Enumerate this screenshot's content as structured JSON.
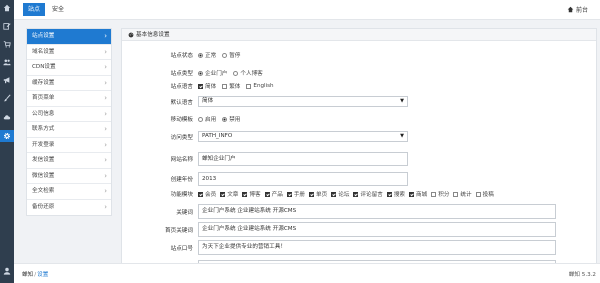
{
  "header": {
    "tabs": [
      "站点",
      "安全"
    ],
    "home_label": "前台"
  },
  "sidebar": {
    "items": [
      {
        "label": "站点设置"
      },
      {
        "label": "域名设置"
      },
      {
        "label": "CDN设置"
      },
      {
        "label": "缓存设置"
      },
      {
        "label": "首页菜单"
      },
      {
        "label": "公司信息"
      },
      {
        "label": "联系方式"
      },
      {
        "label": "开发登录"
      },
      {
        "label": "发信设置"
      },
      {
        "label": "微信设置"
      },
      {
        "label": "全文检索"
      },
      {
        "label": "备份还原"
      }
    ]
  },
  "panel": {
    "title": "基本信息设置",
    "site_status": {
      "label": "站点状态",
      "options": [
        "正常",
        "暂停"
      ],
      "selected": "正常"
    },
    "site_type": {
      "label": "站点类型",
      "options": [
        "企业门户",
        "个人博客"
      ],
      "selected": "企业门户"
    },
    "site_language": {
      "label": "站点语言",
      "options": [
        {
          "text": "简体",
          "checked": true
        },
        {
          "text": "繁体",
          "checked": false
        },
        {
          "text": "English",
          "checked": false
        }
      ]
    },
    "default_language": {
      "label": "默认语言",
      "value": "简体"
    },
    "mobile_template": {
      "label": "移动模板",
      "options": [
        "启用",
        "禁用"
      ],
      "selected": "禁用"
    },
    "access_type": {
      "label": "访问类型",
      "value": "PATH_INFO"
    },
    "site_name": {
      "label": "网站名称",
      "value": "蝉知企业门户"
    },
    "founded_year": {
      "label": "创建年份",
      "value": "2013"
    },
    "modules": {
      "label": "功能模块",
      "items": [
        {
          "text": "会员",
          "checked": true
        },
        {
          "text": "文章",
          "checked": true
        },
        {
          "text": "博客",
          "checked": true
        },
        {
          "text": "产品",
          "checked": true
        },
        {
          "text": "手册",
          "checked": true
        },
        {
          "text": "单页",
          "checked": true
        },
        {
          "text": "论坛",
          "checked": true
        },
        {
          "text": "评论留言",
          "checked": true
        },
        {
          "text": "搜索",
          "checked": true
        },
        {
          "text": "商城",
          "checked": true
        },
        {
          "text": "积分",
          "checked": false
        },
        {
          "text": "统计",
          "checked": false
        },
        {
          "text": "投稿",
          "checked": false
        }
      ]
    },
    "keywords": {
      "label": "关键词",
      "value": "企业门户系统 企业建站系统 开源CMS"
    },
    "home_keywords": {
      "label": "首页关键词",
      "value": "企业门户系统 企业建站系统 开源CMS"
    },
    "slogan": {
      "label": "站点口号",
      "value": "为天下企业提供专业的营销工具！"
    }
  },
  "footer": {
    "crumb_root": "蝉知",
    "crumb_page": "设置",
    "version": "蝉知 5.3.2"
  },
  "icons": {
    "rail": [
      "home-icon",
      "edit-icon",
      "cart-icon",
      "users-icon",
      "bullhorn-icon",
      "brush-icon",
      "cloud-icon",
      "gear-icon",
      "user-icon"
    ]
  },
  "colors": {
    "accent": "#1f7ad1",
    "rail": "#2f3e4e"
  }
}
